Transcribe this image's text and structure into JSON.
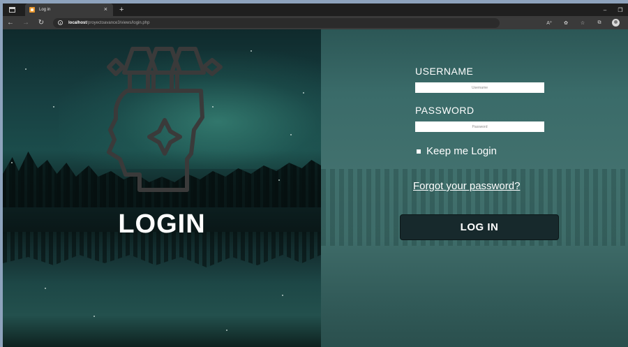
{
  "browser": {
    "tab": {
      "title": "Log in",
      "close": "×"
    },
    "new_tab": "+",
    "window_controls": {
      "minimize": "–",
      "restore": "❐"
    },
    "address": {
      "host": "localhost",
      "path": "/proyectoavance3/views/login.php"
    },
    "nav": {
      "back": "←",
      "forward": "→",
      "reload": "↻"
    },
    "tools": {
      "read_aloud": "A⁰",
      "tracking": "✿",
      "favorites": "☆",
      "collections": "⧉"
    }
  },
  "left": {
    "heading": "LOGIN",
    "logo_icon": "head-stars-icon"
  },
  "form": {
    "username_label": "USERNAME",
    "username_placeholder": "Username",
    "password_label": "PASSWORD",
    "password_placeholder": "Password",
    "keep_login_label": "Keep me Login",
    "forgot_link": "Forgot your password?",
    "submit_label": "LOG IN"
  },
  "colors": {
    "button_bg": "#17292c",
    "right_panel": "#3f6c69",
    "left_panel": "#173f41",
    "logo_stroke": "#3a3a3a"
  }
}
